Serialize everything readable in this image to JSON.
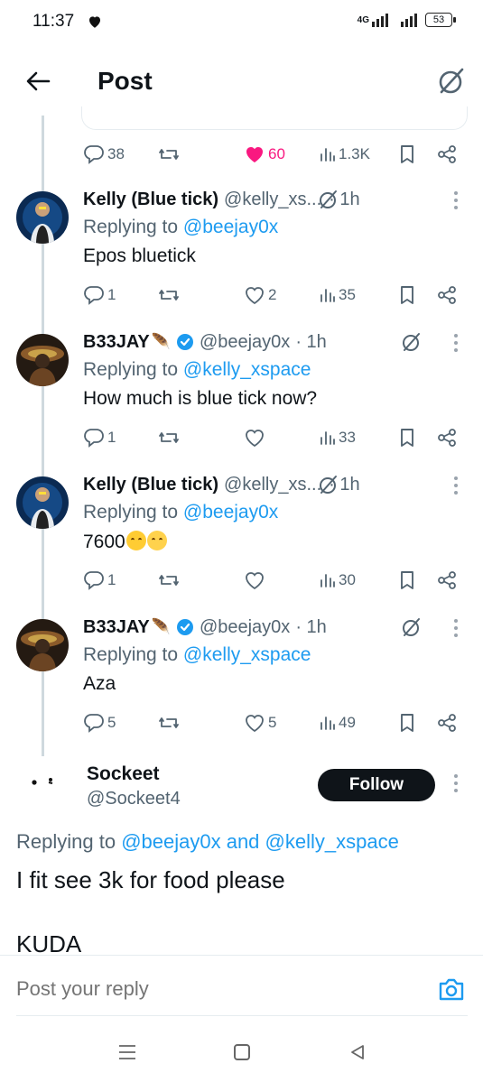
{
  "status_bar": {
    "time": "11:37",
    "network": "4G",
    "battery": "53"
  },
  "header": {
    "title": "Post"
  },
  "top_actions": {
    "replies": "38",
    "likes": "60",
    "views": "1.3K"
  },
  "replies": [
    {
      "name": "Kelly (Blue tick)",
      "handle": "@kelly_xs...",
      "time": "· 1h",
      "replying_prefix": "Replying to ",
      "replying_to": "@beejay0x",
      "text": "Epos bluetick",
      "replies": "1",
      "likes": "2",
      "views": "35"
    },
    {
      "name": "B33JAY",
      "handle": "@beejay0x",
      "time": "· 1h",
      "replying_prefix": "Replying to ",
      "replying_to": "@kelly_xspace",
      "text": "How much is blue tick now?",
      "replies": "1",
      "likes": "",
      "views": "33"
    },
    {
      "name": "Kelly (Blue tick)",
      "handle": "@kelly_xs...",
      "time": "· 1h",
      "replying_prefix": "Replying to ",
      "replying_to": "@beejay0x",
      "text": "7600",
      "replies": "1",
      "likes": "",
      "views": "30"
    },
    {
      "name": "B33JAY",
      "handle": "@beejay0x",
      "time": "· 1h",
      "replying_prefix": "Replying to ",
      "replying_to": "@kelly_xspace",
      "text": "Aza",
      "replies": "5",
      "likes": "5",
      "views": "49"
    }
  ],
  "main_post": {
    "name": "Sockeet",
    "handle": "@Sockeet4",
    "follow_label": "Follow",
    "replying_prefix": "Replying to ",
    "replying_to_1": "@beejay0x",
    "replying_and": " and ",
    "replying_to_2": "@kelly_xspace",
    "text": "I fit see 3k for food please",
    "text2": "KUDA"
  },
  "reply_bar": {
    "placeholder": "Post your reply"
  },
  "colors": {
    "accent": "#1d9bf0",
    "like": "#f91880",
    "muted": "#536471"
  }
}
